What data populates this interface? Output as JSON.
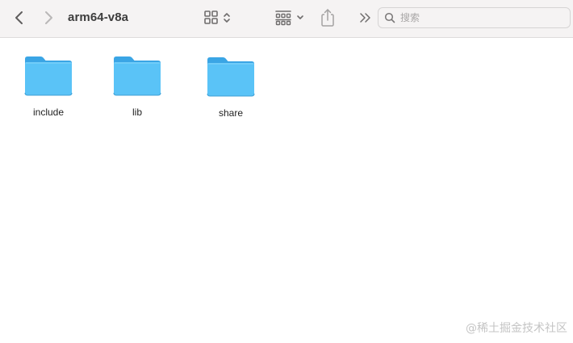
{
  "window": {
    "title": "arm64-v8a"
  },
  "toolbar": {
    "back_icon": "chevron-left-icon",
    "forward_icon": "chevron-right-icon",
    "view_icon": "icon-grid-view-icon",
    "group_icon": "group-by-icon",
    "share_icon": "share-icon",
    "more_icon": "double-chevron-icon"
  },
  "search": {
    "placeholder": "搜索",
    "value": ""
  },
  "folders": [
    {
      "label": "include",
      "icon": "folder-icon"
    },
    {
      "label": "lib",
      "icon": "folder-icon"
    },
    {
      "label": "share",
      "icon": "folder-icon"
    }
  ],
  "colors": {
    "folder_body": "#5ac3f7",
    "folder_back": "#3aa5e5",
    "toolbar_bg": "#f5f3f3",
    "icon_gray": "#6f6d6d"
  },
  "watermark": "@稀土掘金技术社区"
}
